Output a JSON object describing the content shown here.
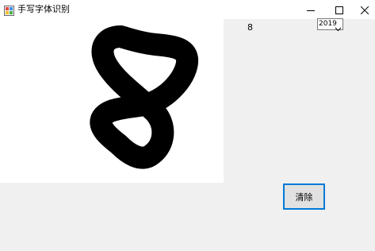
{
  "window": {
    "title": "手写字体识别",
    "controls": {
      "minimize_icon": "minimize-icon",
      "maximize_icon": "maximize-icon",
      "close_icon": "close-icon"
    }
  },
  "canvas": {
    "background": "#ffffff",
    "stroke_color": "#000000"
  },
  "result": {
    "prediction": "8"
  },
  "combo": {
    "selected": "2019"
  },
  "actions": {
    "clear_label": "清除"
  },
  "colors": {
    "accent": "#0078d7",
    "form_bg": "#f0f0f0"
  }
}
